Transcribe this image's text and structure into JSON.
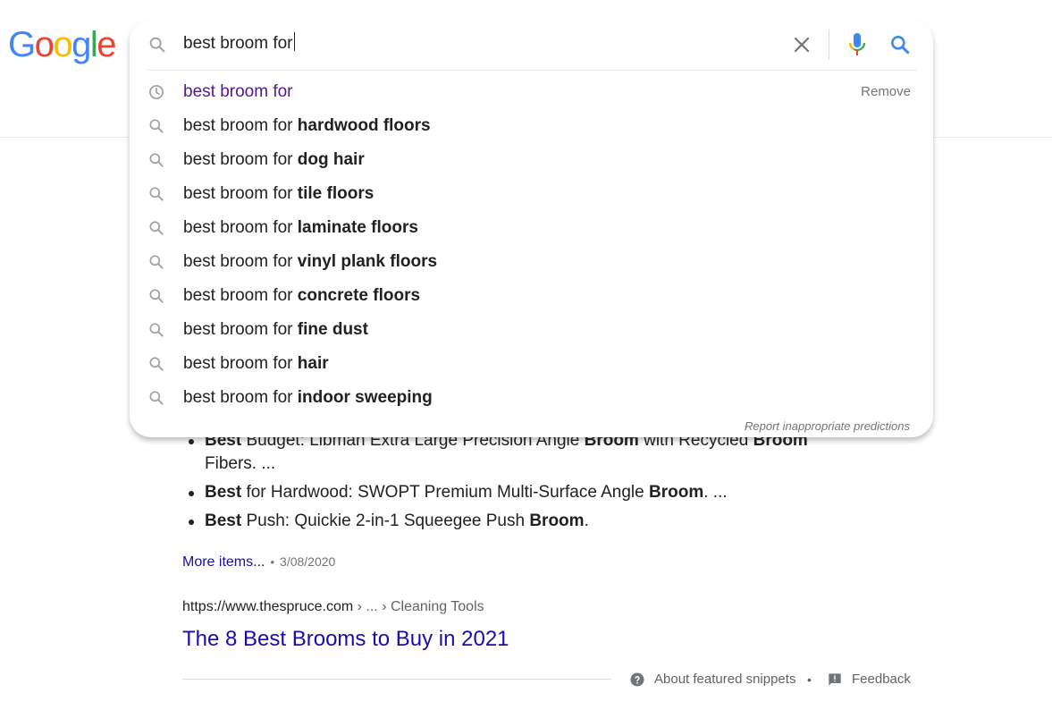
{
  "logo": {
    "letters": [
      "G",
      "o",
      "o",
      "g",
      "l",
      "e"
    ],
    "colors": [
      "#4285f4",
      "#ea4335",
      "#fbbc05",
      "#4285f4",
      "#34a853",
      "#ea4335"
    ]
  },
  "search": {
    "query": "best broom for"
  },
  "suggestions": [
    {
      "type": "history",
      "prefix": "best broom for",
      "suffix": ""
    },
    {
      "type": "search",
      "prefix": "best broom for ",
      "suffix": "hardwood floors"
    },
    {
      "type": "search",
      "prefix": "best broom for ",
      "suffix": "dog hair"
    },
    {
      "type": "search",
      "prefix": "best broom for ",
      "suffix": "tile floors"
    },
    {
      "type": "search",
      "prefix": "best broom for ",
      "suffix": "laminate floors"
    },
    {
      "type": "search",
      "prefix": "best broom for ",
      "suffix": "vinyl plank floors"
    },
    {
      "type": "search",
      "prefix": "best broom for ",
      "suffix": "concrete floors"
    },
    {
      "type": "search",
      "prefix": "best broom for ",
      "suffix": "fine dust"
    },
    {
      "type": "search",
      "prefix": "best broom for ",
      "suffix": "hair"
    },
    {
      "type": "search",
      "prefix": "best broom for ",
      "suffix": "indoor sweeping"
    }
  ],
  "remove_label": "Remove",
  "report_label": "Report inappropriate predictions",
  "results": {
    "bullets": [
      [
        {
          "t": "Best",
          "b": true
        },
        {
          "t": " Budget: Libman Extra Large Precision Angle ",
          "b": false
        },
        {
          "t": "Broom",
          "b": true
        },
        {
          "t": " with Recycled ",
          "b": false
        },
        {
          "t": "Broom",
          "b": true
        },
        {
          "t": " Fibers. ...",
          "b": false
        }
      ],
      [
        {
          "t": "Best",
          "b": true
        },
        {
          "t": " for Hardwood: SWOPT Premium Multi-Surface Angle ",
          "b": false
        },
        {
          "t": "Broom",
          "b": true
        },
        {
          "t": ". ...",
          "b": false
        }
      ],
      [
        {
          "t": "Best",
          "b": true
        },
        {
          "t": " Push: Quickie 2-in-1 Squeegee Push ",
          "b": false
        },
        {
          "t": "Broom",
          "b": true
        },
        {
          "t": ".",
          "b": false
        }
      ]
    ],
    "more_items": "More items...",
    "date": "3/08/2020",
    "cite_url": "https://www.thespruce.com",
    "cite_crumb": " › ... › Cleaning Tools",
    "title": "The 8 Best Brooms to Buy in 2021",
    "about_snippets": "About featured snippets",
    "feedback": "Feedback",
    "dot": "•"
  }
}
